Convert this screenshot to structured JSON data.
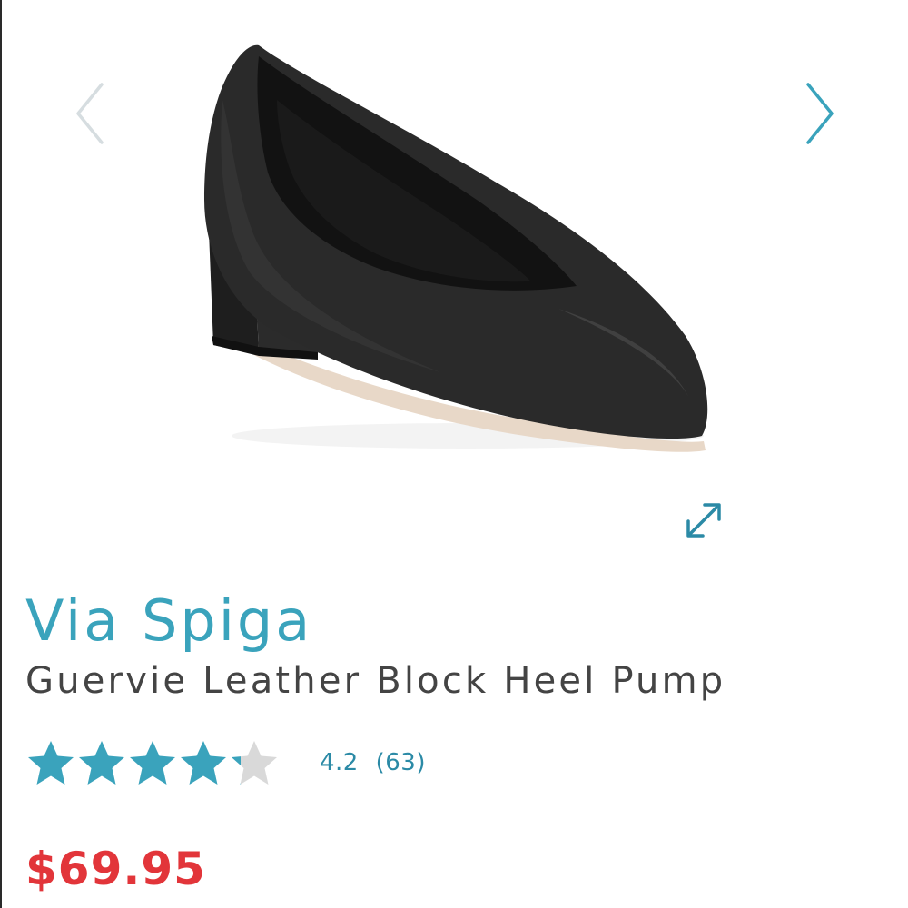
{
  "product": {
    "brand": "Via Spiga",
    "name": "Guervie Leather Block Heel Pump",
    "image_alt_icon": "shoe-image",
    "price": "$69.95"
  },
  "gallery": {
    "prev_icon": "chevron-left-icon",
    "next_icon": "chevron-right-icon",
    "expand_icon": "expand-icon"
  },
  "rating": {
    "value": 4.2,
    "max": 5,
    "value_label": "4.2",
    "count_label": "(63)"
  },
  "colors": {
    "accent": "#3aa3bc",
    "star_filled": "#3aa3bc",
    "star_empty": "#d9d9d9",
    "price": "#e2353a",
    "text": "#444444",
    "arrow_disabled": "#d6dde0",
    "arrow_active": "#3aa3bc"
  }
}
